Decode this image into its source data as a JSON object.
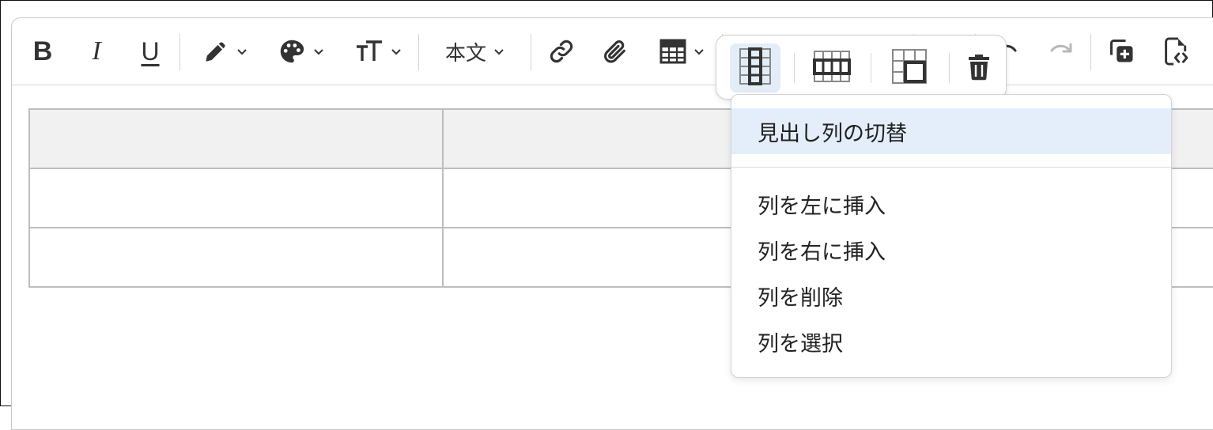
{
  "toolbar": {
    "bold_label": "B",
    "italic_label": "I",
    "underline_label": "U",
    "text_style_label": "本文",
    "icons": {
      "pen": "pen-icon",
      "palette": "palette-icon",
      "font_size": "font-size-icon",
      "link": "link-icon",
      "attachment": "paperclip-icon",
      "table": "table-icon",
      "undo": "undo-icon",
      "redo": "redo-icon",
      "duplicate": "duplicate-icon",
      "source": "file-code-icon"
    }
  },
  "table_toolbar": {
    "buttons": [
      "column-options-icon",
      "row-options-icon",
      "cell-options-icon",
      "trash-icon"
    ],
    "active_index": 0
  },
  "column_menu": {
    "items": [
      {
        "label": "見出し列の切替",
        "highlighted": true
      },
      {
        "label": "列を左に挿入"
      },
      {
        "label": "列を右に挿入"
      },
      {
        "label": "列を削除"
      },
      {
        "label": "列を選択"
      }
    ]
  },
  "colors": {
    "accent_bg": "#e2edf8",
    "header_cell_bg": "#f1f1f1",
    "icon": "#333333",
    "disabled_icon": "#b8b8b8"
  }
}
